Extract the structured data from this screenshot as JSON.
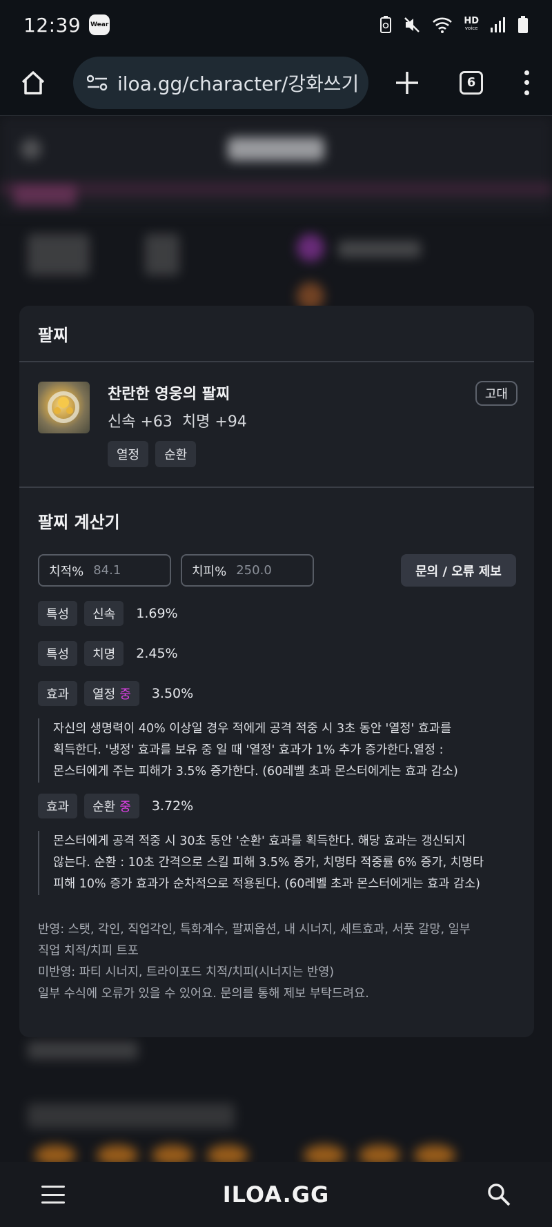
{
  "status_bar": {
    "time": "12:39",
    "wear_badge": "Wear",
    "hd_label": "HD",
    "voice_label": "voice"
  },
  "browser": {
    "url": "iloa.gg/character/강화쓰기",
    "tab_count": "6"
  },
  "card": {
    "title": "팔찌",
    "item": {
      "name": "찬란한 영웅의 팔찌",
      "stat1": "신속 +63",
      "stat2": "치명 +94",
      "tags": [
        "열정",
        "순환"
      ],
      "grade": "고대"
    },
    "calculator": {
      "title": "팔찌 계산기",
      "crit_rate_label": "치적%",
      "crit_rate_value": "84.1",
      "crit_dmg_label": "치피%",
      "crit_dmg_value": "250.0",
      "report_button": "문의 / 오류 제보",
      "rows": [
        {
          "kind": "특성",
          "name": "신속",
          "mid": "",
          "value": "1.69%"
        },
        {
          "kind": "특성",
          "name": "치명",
          "mid": "",
          "value": "2.45%"
        },
        {
          "kind": "효과",
          "name": "열정",
          "mid": "중",
          "value": "3.50%"
        },
        {
          "kind": "효과",
          "name": "순환",
          "mid": "중",
          "value": "3.72%"
        }
      ],
      "desc_passion": [
        "자신의 생명력이 40% 이상일 경우 적에게 공격 적중 시 3초 동안 '열정' 효과를",
        "획득한다. '냉정' 효과를 보유 중 일 때 '열정' 효과가 1% 추가 증가한다.열정 :",
        "몬스터에게 주는 피해가 3.5% 증가한다. (60레벨 초과 몬스터에게는 효과 감소)"
      ],
      "desc_cycle": [
        "몬스터에게 공격 적중 시 30초 동안 '순환' 효과를 획득한다. 해당 효과는 갱신되지",
        "않는다. 순환 : 10초 간격으로 스킬 피해 3.5% 증가, 치명타 적중률 6% 증가, 치명타",
        "피해 10% 증가 효과가 순차적으로 적용된다. (60레벨 초과 몬스터에게는 효과 감소)"
      ],
      "notes": [
        "반영: 스탯, 각인, 직업각인, 특화계수, 팔찌옵션, 내 시너지, 세트효과, 서풋 갈망, 일부",
        "직업 치적/치피 트포",
        "미반영: 파티 시너지, 트라이포드 치적/치피(시너지는 반영)",
        "일부 수식에 오류가 있을 수 있어요. 문의를 통해 제보 부탁드려요."
      ]
    }
  },
  "bottom_nav": {
    "brand": "ILOA.GG"
  }
}
